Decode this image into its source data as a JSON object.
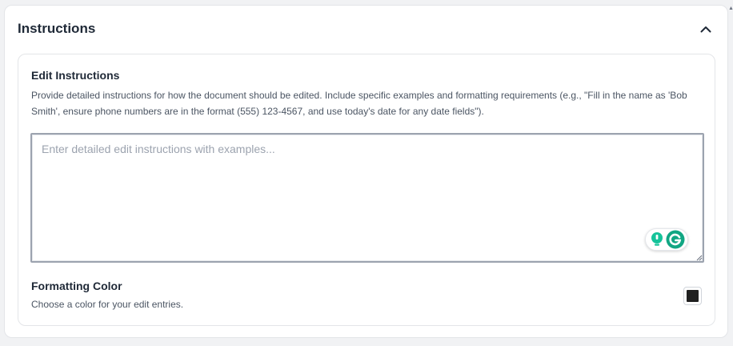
{
  "panel": {
    "title": "Instructions"
  },
  "edit_instructions": {
    "title": "Edit Instructions",
    "description": "Provide detailed instructions for how the document should be edited. Include specific examples and formatting requirements (e.g., \"Fill in the name as 'Bob Smith', ensure phone numbers are in the format (555) 123-4567, and use today's date for any date fields\").",
    "textarea_value": "",
    "textarea_placeholder": "Enter detailed edit instructions with examples..."
  },
  "formatting_color": {
    "title": "Formatting Color",
    "description": "Choose a color for your edit entries.",
    "value": "#1f1f1f"
  },
  "icons": {
    "collapse": "chevron-up-icon",
    "suggestion": "lightbulb-icon",
    "grammarly": "grammarly-icon"
  },
  "colors": {
    "grammarly_green": "#15c39a",
    "grammarly_dark_green": "#11a683"
  }
}
